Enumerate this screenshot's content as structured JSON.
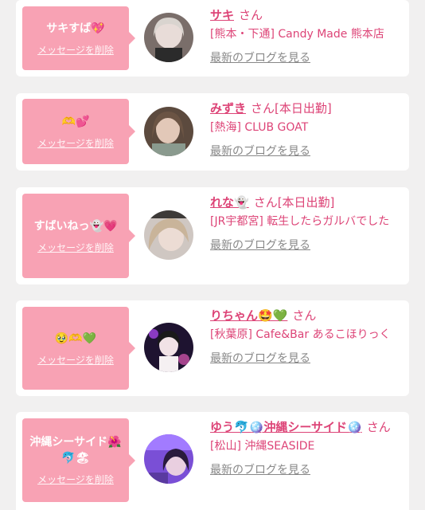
{
  "cards": [
    {
      "bubble_message": "サキすば💖",
      "delete_label": "メッセージを削除",
      "name": "サキ",
      "honorific": "さん",
      "status": "",
      "shop": "[熊本・下通] Candy Made 熊本店",
      "blog_link": "最新のブログを見る"
    },
    {
      "bubble_message": "🫶💕",
      "delete_label": "メッセージを削除",
      "name": "みずき",
      "honorific": "さん",
      "status": "[本日出勤]",
      "shop": "[熱海] CLUB GOAT",
      "blog_link": "最新のブログを見る"
    },
    {
      "bubble_message": "すばいねっ👻💗",
      "delete_label": "メッセージを削除",
      "name": "れな👻",
      "honorific": "さん",
      "status": "[本日出勤]",
      "shop": "[JR宇都宮] 転生したらガルバでした",
      "blog_link": "最新のブログを見る"
    },
    {
      "bubble_message": "🥹🫶💚",
      "delete_label": "メッセージを削除",
      "name": "りちゃん🤩💚",
      "honorific": "さん",
      "status": "",
      "shop": "[秋葉原] Cafe&Bar あるこほりっく",
      "blog_link": "最新のブログを見る"
    },
    {
      "bubble_message": "沖縄シーサイド🌺🐬🏖",
      "delete_label": "メッセージを削除",
      "name": "ゆう🐬🪩沖縄シーサイド🪩",
      "honorific": "さん",
      "status": "",
      "shop": "[松山] 沖縄SEASIDE",
      "blog_link": "最新のブログを見る"
    }
  ]
}
